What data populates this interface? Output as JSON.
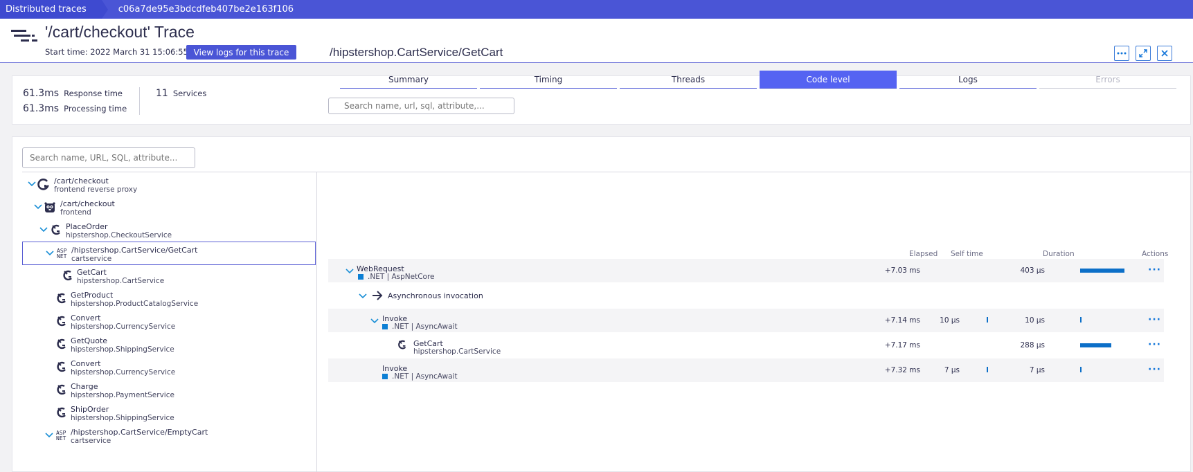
{
  "breadcrumb": {
    "first": "Distributed traces",
    "second": "c06a7de95e3bdcdfeb407be2e163f106"
  },
  "header": {
    "title": "'/cart/checkout' Trace",
    "start_time": "Start time: 2022 March 31 15:06:55",
    "logs_button": "View logs for this trace"
  },
  "metrics": {
    "response_value": "61.3ms",
    "response_label": "Response time",
    "processing_value": "61.3ms",
    "processing_label": "Processing time",
    "services_value": "11",
    "services_label": "Services"
  },
  "search": {
    "placeholder": "Search name, URL, SQL, attribute..."
  },
  "tree": [
    {
      "name": "/cart/checkout",
      "sub": "frontend reverse proxy",
      "icon": "proxy-icon"
    },
    {
      "name": "/cart/checkout",
      "sub": "frontend",
      "icon": "gopher-icon"
    },
    {
      "name": "PlaceOrder",
      "sub": "hipstershop.CheckoutService",
      "icon": "grpc-icon"
    },
    {
      "name": "/hipstershop.CartService/GetCart",
      "sub": "cartservice",
      "icon": "asp-net-icon",
      "icon_text_top": "ASP",
      "icon_text_bottom": "NET"
    },
    {
      "name": "GetCart",
      "sub": "hipstershop.CartService",
      "icon": "grpc-icon"
    },
    {
      "name": "GetProduct",
      "sub": "hipstershop.ProductCatalogService",
      "icon": "grpc-icon"
    },
    {
      "name": "Convert",
      "sub": "hipstershop.CurrencyService",
      "icon": "grpc-icon"
    },
    {
      "name": "GetQuote",
      "sub": "hipstershop.ShippingService",
      "icon": "grpc-icon"
    },
    {
      "name": "Convert",
      "sub": "hipstershop.CurrencyService",
      "icon": "grpc-icon"
    },
    {
      "name": "Charge",
      "sub": "hipstershop.PaymentService",
      "icon": "grpc-icon"
    },
    {
      "name": "ShipOrder",
      "sub": "hipstershop.ShippingService",
      "icon": "grpc-icon"
    },
    {
      "name": "/hipstershop.CartService/EmptyCart",
      "sub": "cartservice",
      "icon": "asp-net-icon",
      "icon_text_top": "ASP",
      "icon_text_bottom": "NET"
    }
  ],
  "detail": {
    "title": "/hipstershop.CartService/GetCart",
    "tabs": [
      "Summary",
      "Timing",
      "Threads",
      "Code level",
      "Logs",
      "Errors"
    ],
    "active_tab": "Code level",
    "search_placeholder": "Search name, url, sql, attribute,...",
    "columns": {
      "elapsed": "Elapsed",
      "self_time": "Self time",
      "duration": "Duration",
      "actions": "Actions"
    },
    "rows": [
      {
        "name": "WebRequest",
        "sub": ".NET | AspNetCore",
        "elapsed": "+7.03 ms",
        "self_time": "",
        "duration": "403 μs",
        "duration_fraction": 1.0
      },
      {
        "name": "Asynchronous invocation"
      },
      {
        "name": "Invoke",
        "sub": ".NET | AsyncAwait",
        "elapsed": "+7.14 ms",
        "self_time": "10 μs",
        "duration": "10 μs",
        "duration_fraction": 0.025
      },
      {
        "name": "GetCart",
        "sub": "hipstershop.CartService",
        "elapsed": "+7.17 ms",
        "self_time": "",
        "duration": "288 μs",
        "duration_fraction": 0.71
      },
      {
        "name": "Invoke",
        "sub": ".NET | AsyncAwait",
        "elapsed": "+7.32 ms",
        "self_time": "7 μs",
        "duration": "7 μs",
        "duration_fraction": 0.017
      }
    ],
    "accent_color": "#0c6fc8",
    "active_tab_color": "#5563f2"
  },
  "colors": {
    "topbar": "#4a55d6",
    "brand": "#4a55d6"
  }
}
